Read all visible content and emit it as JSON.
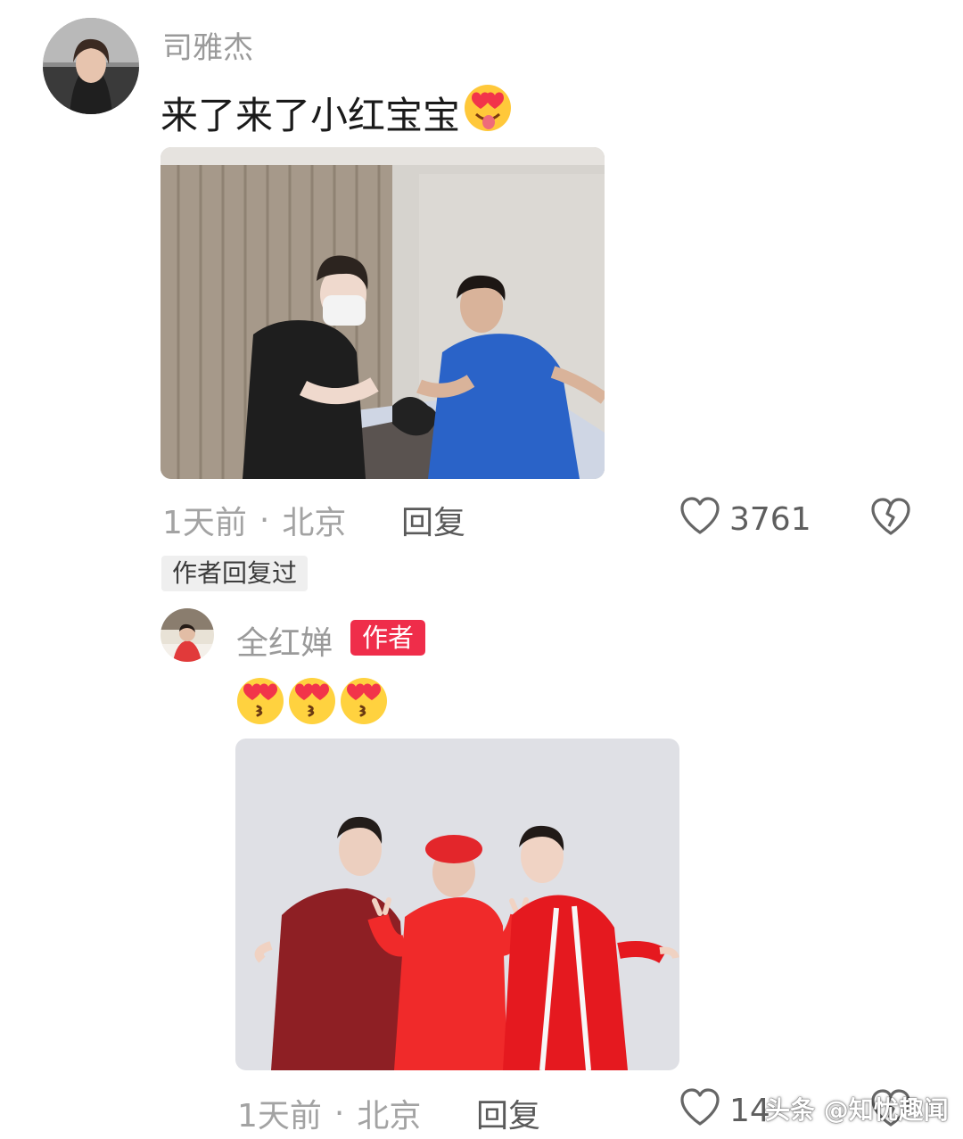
{
  "comment": {
    "username": "司雅杰",
    "text": "来了来了小红宝宝",
    "text_emoji_icon": "heart-eyes-tongue-emoji",
    "meta": {
      "time": "1天前",
      "separator": "·",
      "location": "北京"
    },
    "reply_label": "回复",
    "like_count": "3761",
    "author_replied_tag": "作者回复过"
  },
  "reply": {
    "username": "全红婵",
    "author_badge": "作者",
    "emoji_icons": [
      "heart-eyes-kiss-emoji",
      "heart-eyes-kiss-emoji",
      "heart-eyes-kiss-emoji"
    ],
    "meta": {
      "time": "1天前",
      "separator": "·",
      "location": "北京"
    },
    "reply_label": "回复",
    "like_count": "14"
  },
  "watermark": "头条 @知忧趣闻",
  "colors": {
    "accent_red": "#ef2d4a",
    "username_gray": "#9a9a9a",
    "meta_gray": "#a3a3a3"
  }
}
